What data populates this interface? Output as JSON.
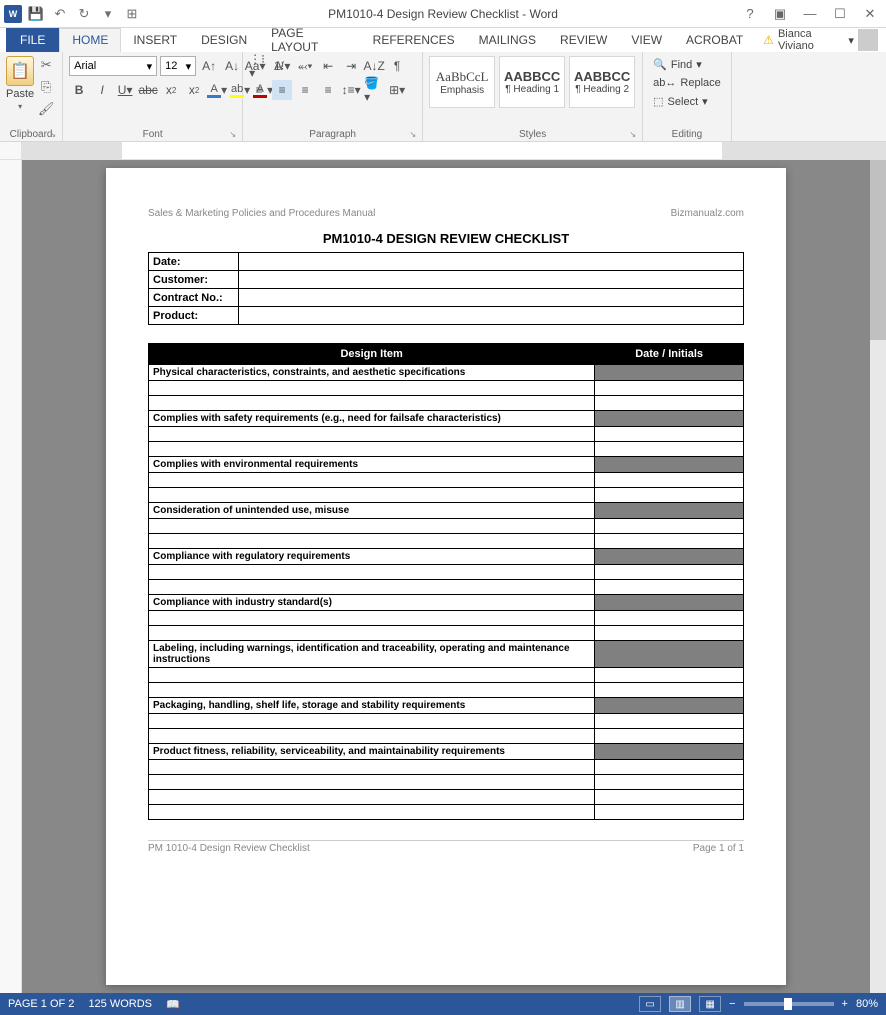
{
  "titlebar": {
    "title": "PM1010-4 Design Review Checklist - Word"
  },
  "account": {
    "name": "Bianca Viviano"
  },
  "tabs": {
    "file": "FILE",
    "home": "HOME",
    "insert": "INSERT",
    "design": "DESIGN",
    "page_layout": "PAGE LAYOUT",
    "references": "REFERENCES",
    "mailings": "MAILINGS",
    "review": "REVIEW",
    "view": "VIEW",
    "acrobat": "ACROBAT"
  },
  "ribbon": {
    "clipboard": {
      "paste": "Paste",
      "label": "Clipboard"
    },
    "font": {
      "name": "Arial",
      "size": "12",
      "label": "Font"
    },
    "paragraph": {
      "label": "Paragraph"
    },
    "styles": {
      "label": "Styles",
      "items": [
        {
          "preview": "AaBbCcL",
          "name": "Emphasis"
        },
        {
          "preview": "AABBCC",
          "name": "¶ Heading 1"
        },
        {
          "preview": "AABBCC",
          "name": "¶ Heading 2"
        }
      ]
    },
    "editing": {
      "find": "Find",
      "replace": "Replace",
      "select": "Select",
      "label": "Editing"
    }
  },
  "doc": {
    "header_left": "Sales & Marketing Policies and Procedures Manual",
    "header_right": "Bizmanualz.com",
    "title": "PM1010-4 DESIGN REVIEW CHECKLIST",
    "info": {
      "date": "Date:",
      "customer": "Customer:",
      "contract": "Contract No.:",
      "product": "Product:"
    },
    "th1": "Design Item",
    "th2": "Date / Initials",
    "items": [
      "Physical characteristics, constraints, and aesthetic specifications",
      "Complies with safety requirements (e.g., need for failsafe characteristics)",
      "Complies with environmental requirements",
      "Consideration of unintended use, misuse",
      "Compliance with regulatory requirements",
      "Compliance with industry standard(s)",
      "Labeling, including warnings, identification and traceability, operating and maintenance instructions",
      "Packaging, handling, shelf life, storage and stability requirements",
      "Product fitness, reliability, serviceability, and maintainability requirements"
    ],
    "footer_left": "PM 1010-4 Design Review Checklist",
    "footer_right": "Page 1 of 1"
  },
  "status": {
    "page": "PAGE 1 OF 2",
    "words": "125 WORDS",
    "zoom": "80%"
  }
}
